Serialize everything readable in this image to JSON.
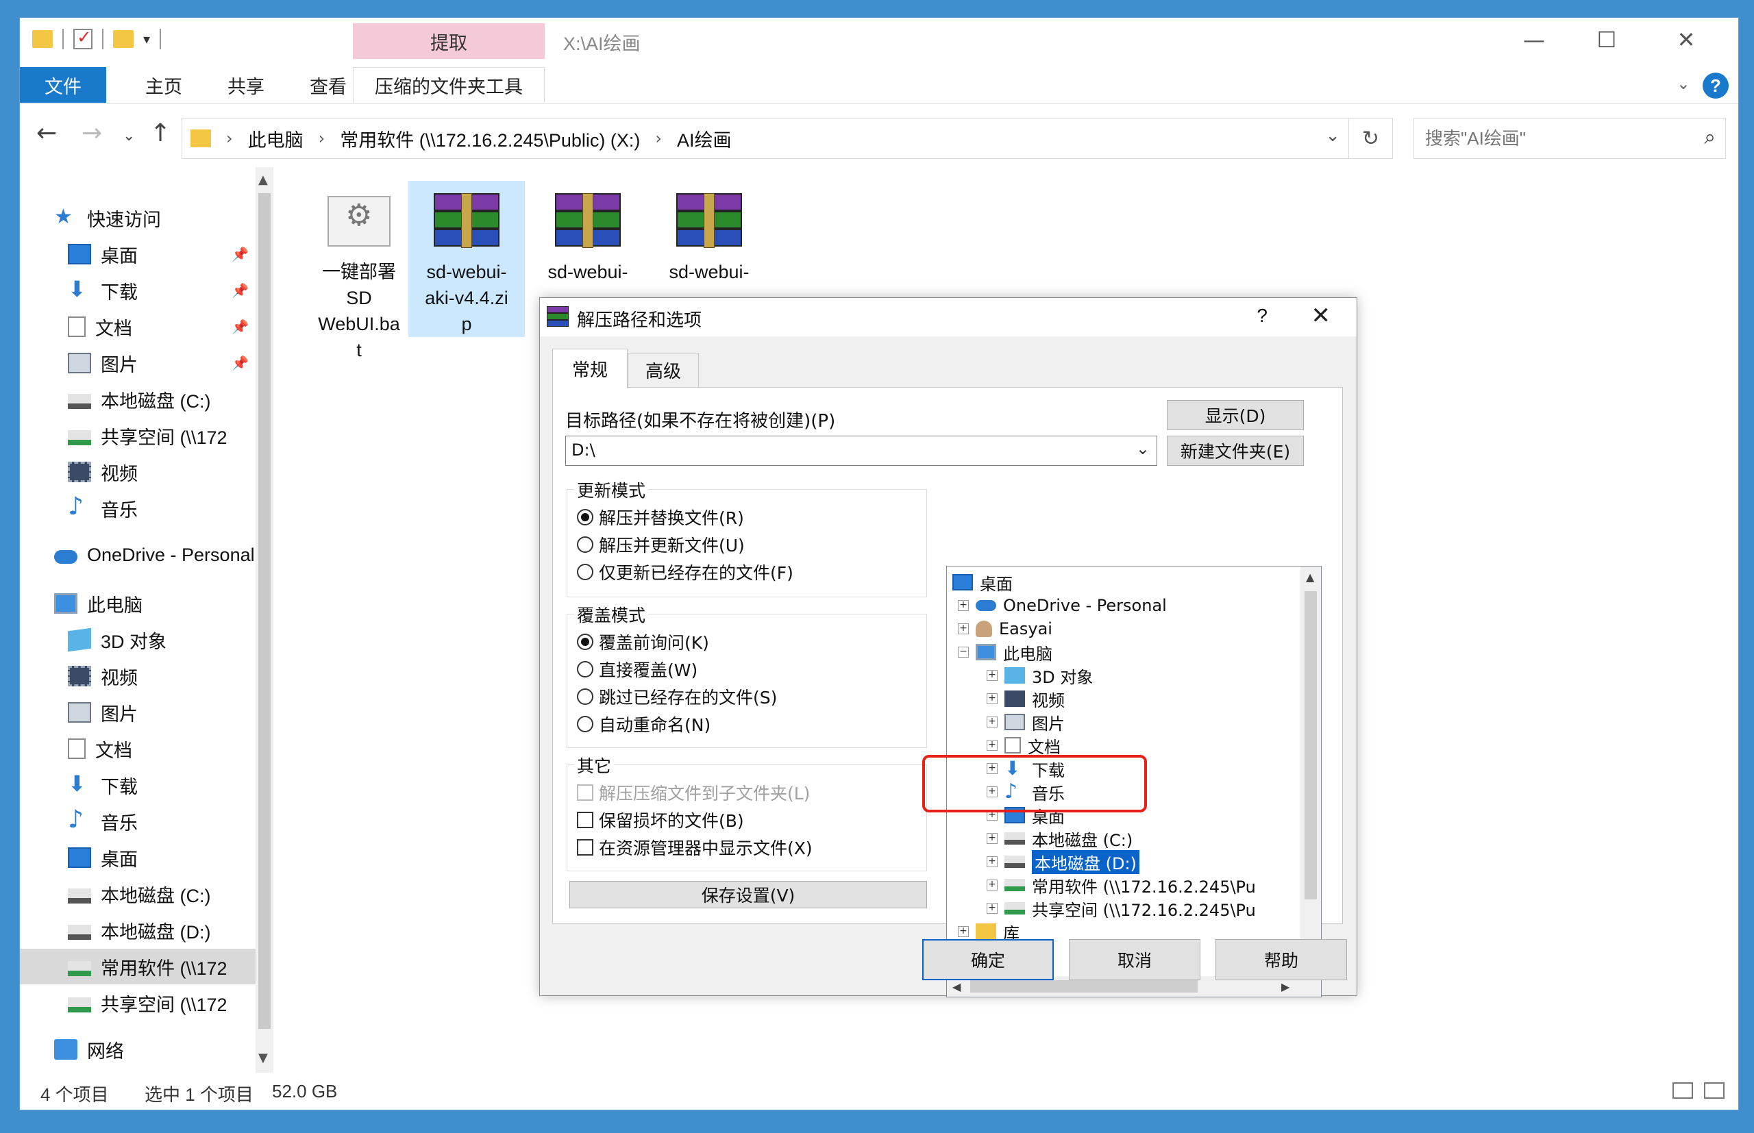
{
  "titlebar": {
    "context_tab_header": "提取",
    "path_title": "X:\\AI绘画",
    "minimize": "—",
    "maximize": "☐",
    "close": "✕"
  },
  "ribbon": {
    "tabs": [
      "文件",
      "主页",
      "共享",
      "查看",
      "压缩的文件夹工具"
    ],
    "help": "?"
  },
  "address": {
    "crumbs": [
      "此电脑",
      "常用软件 (\\\\172.16.2.245\\Public) (X:)",
      "AI绘画"
    ],
    "search_placeholder": "搜索\"AI绘画\""
  },
  "navpane": {
    "items": [
      {
        "label": "快速访问",
        "icon": "star-icon"
      },
      {
        "label": "桌面",
        "icon": "desktop-icon"
      },
      {
        "label": "下载",
        "icon": "download-icon"
      },
      {
        "label": "文档",
        "icon": "document-icon"
      },
      {
        "label": "图片",
        "icon": "picture-icon"
      },
      {
        "label": "本地磁盘 (C:)",
        "icon": "drive-icon"
      },
      {
        "label": "共享空间 (\\\\172",
        "icon": "network-drive-icon"
      },
      {
        "label": "视频",
        "icon": "video-icon"
      },
      {
        "label": "音乐",
        "icon": "music-icon"
      },
      {
        "label": "OneDrive - Personal",
        "icon": "cloud-icon"
      },
      {
        "label": "此电脑",
        "icon": "computer-icon"
      },
      {
        "label": "3D 对象",
        "icon": "cube-icon"
      },
      {
        "label": "视频",
        "icon": "video-icon"
      },
      {
        "label": "图片",
        "icon": "picture-icon"
      },
      {
        "label": "文档",
        "icon": "document-icon"
      },
      {
        "label": "下载",
        "icon": "download-icon"
      },
      {
        "label": "音乐",
        "icon": "music-icon"
      },
      {
        "label": "桌面",
        "icon": "desktop-icon"
      },
      {
        "label": "本地磁盘 (C:)",
        "icon": "drive-icon"
      },
      {
        "label": "本地磁盘 (D:)",
        "icon": "drive-icon"
      },
      {
        "label": "常用软件 (\\\\172",
        "icon": "network-drive-icon"
      },
      {
        "label": "共享空间 (\\\\172",
        "icon": "network-drive-icon"
      },
      {
        "label": "网络",
        "icon": "network-icon"
      }
    ]
  },
  "files": [
    {
      "name": "一键部署SD WebUI.bat",
      "lines": [
        "一键部署",
        "SD",
        "WebUI.ba",
        "t"
      ]
    },
    {
      "name": "sd-webui-aki-v4.4.zip",
      "lines": [
        "sd-webui-",
        "aki-v4.4.zi",
        "p"
      ]
    },
    {
      "name": "sd-webui-",
      "lines": [
        "sd-webui-"
      ]
    },
    {
      "name": "sd-webui-",
      "lines": [
        "sd-webui-"
      ]
    }
  ],
  "statusbar": {
    "count": "4 个项目",
    "selected": "选中 1 个项目",
    "size": "52.0 GB"
  },
  "dialog": {
    "title": "解压路径和选项",
    "help": "?",
    "close": "✕",
    "tabs": [
      "常规",
      "高级"
    ],
    "dest_label": "目标路径(如果不存在将被创建)(P)",
    "dest_value": "D:\\",
    "show_button": "显示(D)",
    "new_folder_button": "新建文件夹(E)",
    "update_mode": {
      "title": "更新模式",
      "options": [
        "解压并替换文件(R)",
        "解压并更新文件(U)",
        "仅更新已经存在的文件(F)"
      ]
    },
    "overwrite_mode": {
      "title": "覆盖模式",
      "options": [
        "覆盖前询问(K)",
        "直接覆盖(W)",
        "跳过已经存在的文件(S)",
        "自动重命名(N)"
      ]
    },
    "other": {
      "title": "其它",
      "options": [
        "解压压缩文件到子文件夹(L)",
        "保留损坏的文件(B)",
        "在资源管理器中显示文件(X)"
      ]
    },
    "save_button": "保存设置(V)",
    "tree": [
      {
        "label": "桌面"
      },
      {
        "label": "OneDrive - Personal"
      },
      {
        "label": "Easyai"
      },
      {
        "label": "此电脑"
      },
      {
        "label": "3D 对象"
      },
      {
        "label": "视频"
      },
      {
        "label": "图片"
      },
      {
        "label": "文档"
      },
      {
        "label": "下载"
      },
      {
        "label": "音乐"
      },
      {
        "label": "桌面"
      },
      {
        "label": "本地磁盘 (C:)"
      },
      {
        "label": "本地磁盘 (D:)"
      },
      {
        "label": "常用软件 (\\\\172.16.2.245\\Pu"
      },
      {
        "label": "共享空间 (\\\\172.16.2.245\\Pu"
      },
      {
        "label": "库"
      }
    ],
    "ok": "确定",
    "cancel": "取消",
    "help_button": "帮助"
  }
}
